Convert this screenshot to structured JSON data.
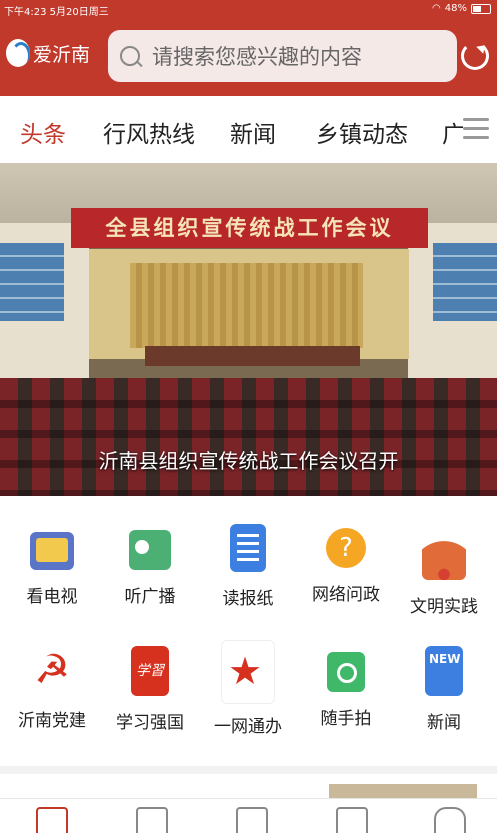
{
  "status": {
    "time_date": "下午4:23  5月20日周三",
    "battery": "48%",
    "battery_level": 0.48
  },
  "app": {
    "logo_text": "爱沂南",
    "search_placeholder": "请搜索您感兴趣的内容"
  },
  "tabs": [
    {
      "label": "头条",
      "active": true
    },
    {
      "label": "行风热线",
      "active": false
    },
    {
      "label": "新闻",
      "active": false
    },
    {
      "label": "乡镇动态",
      "active": false
    },
    {
      "label": "广",
      "active": false
    }
  ],
  "hero": {
    "banner": "全县组织宣传统战工作会议",
    "caption": "沂南县组织宣传统战工作会议召开"
  },
  "grid": [
    {
      "label": "看电视",
      "icon": "tv-icon"
    },
    {
      "label": "听广播",
      "icon": "radio-icon"
    },
    {
      "label": "读报纸",
      "icon": "newspaper-icon"
    },
    {
      "label": "网络问政",
      "icon": "question-bubble-icon"
    },
    {
      "label": "文明实践",
      "icon": "civilization-emblem-icon"
    },
    {
      "label": "沂南党建",
      "icon": "party-emblem-icon"
    },
    {
      "label": "学习强国",
      "icon": "xuexi-icon"
    },
    {
      "label": "一网通办",
      "icon": "star-service-icon"
    },
    {
      "label": "随手拍",
      "icon": "camera-icon"
    },
    {
      "label": "新闻",
      "icon": "new-news-icon"
    }
  ],
  "icon_text": {
    "new_badge": "NEW",
    "xuexi": "学習"
  },
  "colors": {
    "brand_red": "#c0392b",
    "active_tab": "#c0392b"
  }
}
